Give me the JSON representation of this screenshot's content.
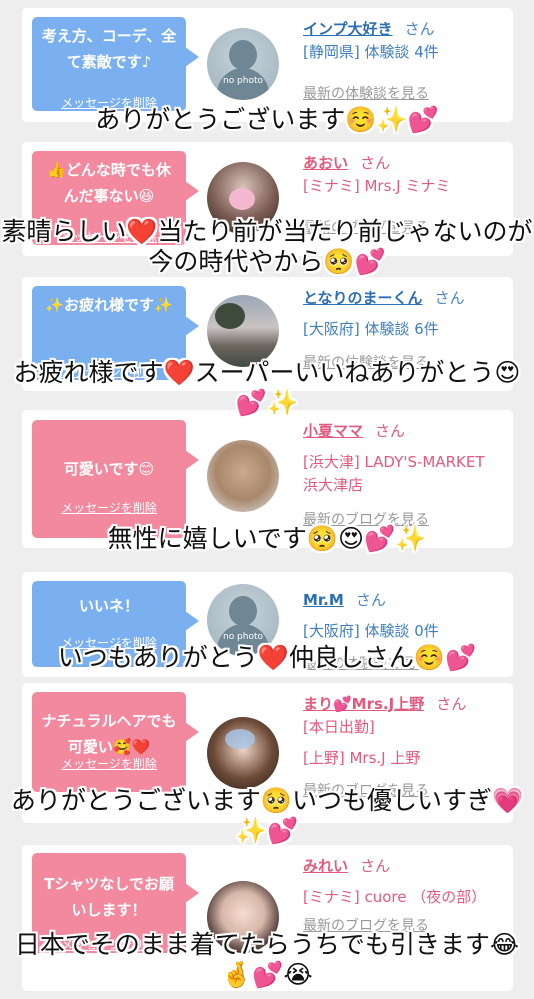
{
  "delete_label": "メッセージを削除",
  "nophoto_label": "no photo",
  "cards": [
    {
      "message": "考え方、コーデ、全て素敵です♪",
      "name": "インプ大好き",
      "san": "さん",
      "line1": "[静岡県] 体験談 4件",
      "line2": "",
      "link": "最新の体験談を見る",
      "overlay": "ありがとうございます☺️✨💕"
    },
    {
      "message": "👍どんな時でも休んだ事ない😆",
      "name": "あおい",
      "san": "さん",
      "line1": "[ミナミ] Mrs.J ミナミ",
      "line2": "",
      "link": "最新のブログを見る",
      "overlay": "素晴らしい❤️当たり前が当たり前じゃないのが今の時代やから🥺💕"
    },
    {
      "message": "✨お疲れ様です✨",
      "name": "となりのまーくん",
      "san": "さん",
      "line1": "[大阪府] 体験談 6件",
      "line2": "",
      "link": "最新の体験談を見る",
      "overlay": "お疲れ様です❤️スーパーいいねありがとう😍💕✨"
    },
    {
      "message": "可愛いです😊",
      "name": "小夏ママ",
      "san": "さん",
      "line1": "[浜大津] LADY'S-MARKET 浜大津店",
      "line2": "",
      "link": "最新のブログを見る",
      "overlay": "無性に嬉しいです🥺😍💕✨"
    },
    {
      "message": "いいネ！",
      "name": "Mr.M",
      "san": "さん",
      "line1": "[大阪府] 体験談 0件",
      "line2": "",
      "link": "最新の体験談を見る",
      "overlay": "いつもありがとう❤️仲良しさん☺️💕"
    },
    {
      "message": "ナチュラルヘアでも可愛い🥰❤️",
      "name": "まり💕Mrs.J上野",
      "san": "さん",
      "line1": "[本日出勤]",
      "line2": "[上野] Mrs.J 上野",
      "link": "最新のブログを見る",
      "overlay": "ありがとうございます🥺いつも優しいすぎ💗✨💕"
    },
    {
      "message": "Tシャツなしでお願いします！",
      "name": "みれい",
      "san": "さん",
      "line1": "[ミナミ] cuore （夜の部）",
      "line2": "",
      "link": "最新のブログを見る",
      "overlay": "日本でそのまま着てたらうちでも引きます😂🤞💕😭"
    }
  ]
}
